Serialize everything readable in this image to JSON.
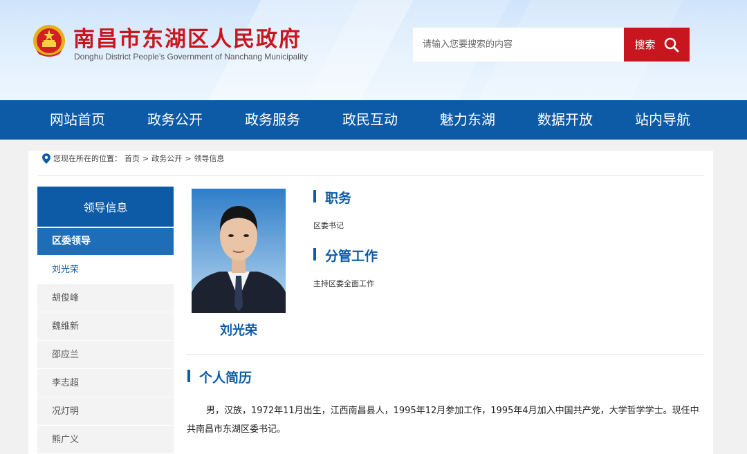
{
  "header": {
    "title": "南昌市东湖区人民政府",
    "subtitle": "Donghu District People’s Government of Nanchang Municipality",
    "search_placeholder": "请输入您要搜索的内容",
    "search_button": "搜索"
  },
  "nav": {
    "items": [
      "网站首页",
      "政务公开",
      "政务服务",
      "政民互动",
      "魅力东湖",
      "数据开放",
      "站内导航"
    ]
  },
  "breadcrumb": {
    "prefix": "您现在所在的位置：",
    "items": [
      "首页",
      "政务公开",
      "领导信息"
    ],
    "separator": ">"
  },
  "sidebar": {
    "heading": "领导信息",
    "category": "区委领导",
    "items": [
      "刘光荣",
      "胡俊峰",
      "魏维新",
      "邵应兰",
      "李志超",
      "况灯明",
      "熊广义"
    ],
    "active_index": 0
  },
  "profile": {
    "name": "刘光荣",
    "position_title": "职务",
    "position": "区委书记",
    "duty_title": "分管工作",
    "duty": "主持区委全面工作",
    "bio_title": "个人简历",
    "bio": "男，汉族，1972年11月出生，江西南昌县人，1995年12月参加工作，1995年4月加入中国共产党，大学哲学学士。现任中共南昌市东湖区委书记。"
  },
  "colors": {
    "brand_blue": "#0d5aa7",
    "brand_red": "#c7161e"
  }
}
